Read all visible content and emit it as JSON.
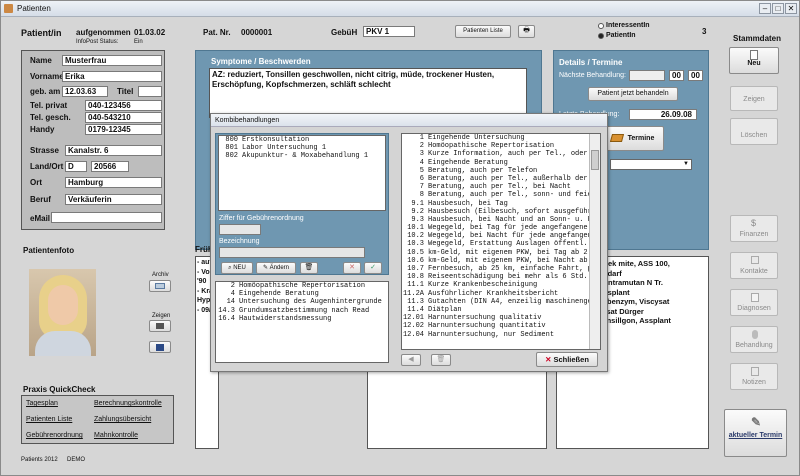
{
  "window": {
    "title": "Patienten"
  },
  "header": {
    "patient_label": "Patient/in",
    "aufgenommen_label": "aufgenommen",
    "aufgenommen_date": "01.03.02",
    "infopost_label": "InfoPost Status:",
    "infopost_value": "Ein",
    "patnr_label": "Pat. Nr.",
    "patnr_value": "0000001",
    "gebuehr_label": "GebüH",
    "gebuehr_value": "PKV 1",
    "liste_button": "Patienten Liste",
    "radio_interessent": "InteressentIn",
    "radio_patient": "PatientIn",
    "count": "3"
  },
  "stammdaten": {
    "title": "Stammdaten",
    "new_button": "Neu",
    "show_button": "Zeigen",
    "delete_button": "Löschen",
    "finance_button": "Finanzen",
    "contacts_button": "Kontakte",
    "diagnoses_button": "Diagnosen",
    "treatment_button": "Behandlung",
    "notes_button": "Notizen",
    "current_term_button": "aktueller Termin"
  },
  "person": {
    "name_label": "Name",
    "name_value": "Musterfrau",
    "vorname_label": "Vorname",
    "vorname_value": "Erika",
    "geb_label": "geb. am",
    "geb_value": "12.03.63",
    "titel_label": "Titel",
    "titel_value": "",
    "tel_privat_label": "Tel. privat",
    "tel_privat_value": "040-123456",
    "tel_gesch_label": "Tel. gesch.",
    "tel_gesch_value": "040-543210",
    "handy_label": "Handy",
    "handy_value": "0179-12345",
    "strasse_label": "Strasse",
    "strasse_value": "Kanalstr. 6",
    "land_label": "Land/Ort",
    "land_value": "D",
    "plz_value": "20566",
    "ort_label": "Ort",
    "ort_value": "Hamburg",
    "beruf_label": "Beruf",
    "beruf_value": "Verkäuferin",
    "email_label": "eMail",
    "email_value": ""
  },
  "photo": {
    "title": "Patientenfoto",
    "archiv_label": "Archiv",
    "zeigen_label": "Zeigen"
  },
  "quickcheck": {
    "title": "Praxis QuickCheck",
    "links": [
      "Tagesplan",
      "Berechnungskontrolle",
      "Patienten Liste",
      "Zahlungsübersicht",
      "Gebührenordnung",
      "Mahnkontrolle"
    ]
  },
  "footer": {
    "label": "Patients 2012",
    "demo": "DEMO"
  },
  "symptome": {
    "title": "Symptome / Beschwerden",
    "text": "AZ: reduziert, Tonsillen geschwollen, nicht citrig, müde, trockener Husten, Erschöpfung, Kopfschmerzen, schläft schlecht"
  },
  "frueh": {
    "label": "Früh",
    "lines": [
      "- aut",
      "- Vor",
      "'90",
      "- Kra",
      "Hyp",
      "- 09/"
    ]
  },
  "details": {
    "title": "Details / Termine",
    "next_label": "Nächste Behandlung:",
    "next_date": "",
    "hour": "00",
    "minute": "00",
    "now_button": "Patient jetzt behandeln",
    "last_label": "Letzte Behandlung:",
    "last_date": "26.09.08",
    "termine_button": "Termine"
  },
  "right_text": {
    "lines": [
      "c zek mite, ASS 100,",
      "Bedarf",
      "Contramutan N Tr.",
      "Assplant",
      "Vobenzym, Viscysat",
      "cysat Dürger",
      "Tonsillgon, Assplant"
    ]
  },
  "dialog": {
    "title": "Kombibehandlungen",
    "top_list": [
      {
        "code": "800",
        "text": "Erstkonsultation"
      },
      {
        "code": "801",
        "text": "Labor Untersuchung 1"
      },
      {
        "code": "802",
        "text": "Akupunktur- & Moxabehandlung 1"
      }
    ],
    "ziffer_label": "Ziffer für Gebührenordnung",
    "ziffer_value": "",
    "bezeichnung_label": "Bezeichnung",
    "bezeichnung_value": "",
    "neu_button": "NEU",
    "aendern_button": "Ändern",
    "bottom_list": [
      {
        "code": "2",
        "text": "Homöopathische Repertorisation"
      },
      {
        "code": "4",
        "text": "Eingehende Beratung"
      },
      {
        "code": "14",
        "text": "Untersuchung des Augenhintergrunde"
      },
      {
        "code": "14.3",
        "text": "Grundumsatzbestimmung nach Read"
      },
      {
        "code": "16.4",
        "text": "Hautwiderstandsmessung"
      }
    ],
    "right_list": [
      {
        "code": "1",
        "text": "Eingehende Untersuchung"
      },
      {
        "code": "2",
        "text": "Homöopathische Repertorisation"
      },
      {
        "code": "3",
        "text": "Kurze Information, auch per Tel., oder Wi"
      },
      {
        "code": "4",
        "text": "Eingehende Beratung"
      },
      {
        "code": "5",
        "text": "Beratung, auch per Telefon"
      },
      {
        "code": "6",
        "text": "Beratung, auch per Tel., außerhalb der Spr"
      },
      {
        "code": "7",
        "text": "Beratung, auch per Tel., bei Nacht"
      },
      {
        "code": "8",
        "text": "Beratung, auch per Tel., sonn- und feiert"
      },
      {
        "code": "9.1",
        "text": "Hausbesuch, bei Tag"
      },
      {
        "code": "9.2",
        "text": "Hausbesuch (Eilbesuch, sofort ausgeführt)"
      },
      {
        "code": "9.3",
        "text": "Hausbesuch, bei Nacht und an Sonn- u. Fei"
      },
      {
        "code": "10.1",
        "text": "Wegegeld, bei Tag für jede angefangene Str"
      },
      {
        "code": "10.2",
        "text": "Wegegeld, bei Nacht für jede angefangene S"
      },
      {
        "code": "10.3",
        "text": "Wegegeld, Erstattung Auslagen öffentl. Ver"
      },
      {
        "code": "10.5",
        "text": "km-Geld, mit eigenem PKW, bei Tag ab 2 km"
      },
      {
        "code": "10.6",
        "text": "km-Geld, mit eigenem PKW, bei Nacht ab 2 l"
      },
      {
        "code": "10.7",
        "text": "Fernbesuch, ab 25 km, einfache Fahrt, pro"
      },
      {
        "code": "10.8",
        "text": "Reiseentschädigung bei mehr als 6 Std. Dau"
      },
      {
        "code": "11.1",
        "text": "Kurze Krankenbescheinigung"
      },
      {
        "code": "11.2A",
        "text": "Ausführlicher Krankheitsbericht"
      },
      {
        "code": "11.3",
        "text": "Gutachten (DIN A4, enzeilig maschinengesc"
      },
      {
        "code": "11.4",
        "text": "Diätplan"
      },
      {
        "code": "12.01",
        "text": "Harnuntersuchung qualitativ"
      },
      {
        "code": "12.02",
        "text": "Harnuntersuchung quantitativ"
      },
      {
        "code": "12.04",
        "text": "Harnuntersuchung, nur Sediment"
      }
    ],
    "close_button": "Schließen"
  }
}
